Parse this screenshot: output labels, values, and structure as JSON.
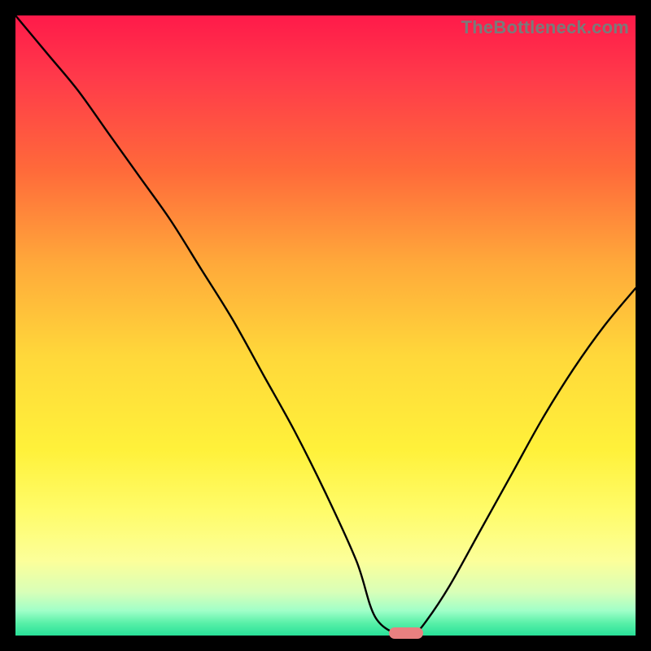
{
  "watermark": "TheBottleneck.com",
  "chart_data": {
    "type": "line",
    "title": "",
    "xlabel": "",
    "ylabel": "",
    "xlim": [
      0,
      100
    ],
    "ylim": [
      0,
      100
    ],
    "series": [
      {
        "name": "bottleneck-curve",
        "x": [
          0,
          5,
          10,
          15,
          20,
          25,
          30,
          35,
          40,
          45,
          50,
          55,
          58,
          62,
          64,
          66,
          70,
          75,
          80,
          85,
          90,
          95,
          100
        ],
        "values": [
          100,
          94,
          88,
          81,
          74,
          67,
          59,
          51,
          42,
          33,
          23,
          12,
          3,
          0,
          0,
          2,
          8,
          17,
          26,
          35,
          43,
          50,
          56
        ]
      }
    ],
    "marker": {
      "x": 63,
      "y": 0
    },
    "gradient_stops": [
      {
        "pos": 0,
        "color": "#ff1a4a"
      },
      {
        "pos": 70,
        "color": "#fff13a"
      },
      {
        "pos": 100,
        "color": "#28e098"
      }
    ]
  }
}
